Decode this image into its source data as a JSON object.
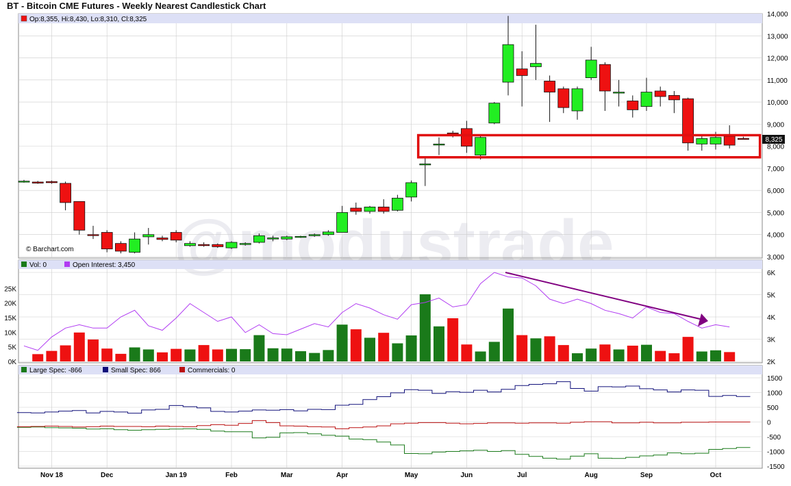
{
  "title": "BT - Bitcoin CME Futures - Weekly Nearest Candlestick Chart",
  "watermark": "@modustrade",
  "colors": {
    "up": "#22ee22",
    "down": "#ee1111",
    "vol_up": "#1a7a1a",
    "vol_down": "#ee1111",
    "oi": "#b13cf2",
    "large_spec": "#1a7a1a",
    "small_spec": "#10107a",
    "commercials": "#bb1111",
    "highlight": "#e01010",
    "arrow": "#800080",
    "legend_bg": "#dde0f6",
    "grid": "#cccccc"
  },
  "chart_data": [
    {
      "type": "candlestick",
      "legend": "Op:8,355, Hi:8,430, Lo:8,310, Cl:8,325",
      "copyright": "© Barchart.com",
      "last_label": "8,325",
      "ylim": [
        3000,
        14000
      ],
      "ytick_values": [
        3000,
        4000,
        5000,
        6000,
        7000,
        8000,
        9000,
        10000,
        11000,
        12000,
        13000,
        14000
      ],
      "ytick_labels": [
        "3,000",
        "4,000",
        "5,000",
        "6,000",
        "7,000",
        "8,000",
        "9,000",
        "10,000",
        "11,000",
        "12,000",
        "13,000",
        "14,000"
      ],
      "candles": [
        [
          6400,
          6480,
          6350,
          6420
        ],
        [
          6380,
          6430,
          6300,
          6330
        ],
        [
          6400,
          6450,
          6300,
          6350
        ],
        [
          6320,
          6400,
          5100,
          5450
        ],
        [
          5500,
          5500,
          4000,
          4200
        ],
        [
          4000,
          4400,
          3800,
          3960
        ],
        [
          4100,
          4200,
          3200,
          3350
        ],
        [
          3600,
          3700,
          3150,
          3250
        ],
        [
          3200,
          4100,
          3150,
          3800
        ],
        [
          3900,
          4300,
          3550,
          4000
        ],
        [
          3850,
          3950,
          3700,
          3780
        ],
        [
          4100,
          4200,
          3650,
          3750
        ],
        [
          3500,
          3700,
          3450,
          3600
        ],
        [
          3550,
          3650,
          3450,
          3500
        ],
        [
          3550,
          3600,
          3400,
          3450
        ],
        [
          3400,
          3700,
          3350,
          3650
        ],
        [
          3550,
          3650,
          3500,
          3600
        ],
        [
          3650,
          4050,
          3600,
          3950
        ],
        [
          3800,
          3950,
          3700,
          3850
        ],
        [
          3800,
          3950,
          3750,
          3900
        ],
        [
          3900,
          3950,
          3850,
          3920
        ],
        [
          3950,
          4050,
          3900,
          4000
        ],
        [
          4000,
          4200,
          3950,
          4120
        ],
        [
          4100,
          5300,
          4100,
          5000
        ],
        [
          5200,
          5450,
          4900,
          5050
        ],
        [
          5050,
          5300,
          4950,
          5250
        ],
        [
          5250,
          5600,
          4950,
          5050
        ],
        [
          5100,
          5800,
          5050,
          5650
        ],
        [
          5700,
          6450,
          5500,
          6350
        ],
        [
          7200,
          7500,
          6200,
          7200
        ],
        [
          8100,
          8400,
          7600,
          8100
        ],
        [
          8600,
          8700,
          8400,
          8550
        ],
        [
          8800,
          9150,
          7700,
          8000
        ],
        [
          7600,
          8500,
          7400,
          8400
        ],
        [
          9050,
          10000,
          9000,
          9950
        ],
        [
          10900,
          13900,
          10300,
          12600
        ],
        [
          11500,
          12300,
          9800,
          11200
        ],
        [
          11600,
          13500,
          11000,
          11750
        ],
        [
          10950,
          11200,
          9100,
          10450
        ],
        [
          10600,
          10700,
          9500,
          9750
        ],
        [
          9600,
          10700,
          9200,
          10600
        ],
        [
          11100,
          12500,
          11000,
          11900
        ],
        [
          11700,
          11800,
          9600,
          10500
        ],
        [
          10450,
          11000,
          9800,
          10450
        ],
        [
          10050,
          10300,
          9300,
          9650
        ],
        [
          9800,
          11100,
          9600,
          10450
        ],
        [
          10500,
          10700,
          9800,
          10250
        ],
        [
          10300,
          10500,
          9500,
          10100
        ],
        [
          10150,
          10200,
          7800,
          8150
        ],
        [
          8100,
          8500,
          7800,
          8350
        ],
        [
          8100,
          8650,
          7850,
          8400
        ],
        [
          8450,
          8950,
          7900,
          8050
        ],
        [
          8355,
          8430,
          8310,
          8325
        ]
      ],
      "x_ticks": [
        {
          "label": "Nov 18",
          "index": 2
        },
        {
          "label": "Dec",
          "index": 6
        },
        {
          "label": "Jan 19",
          "index": 11
        },
        {
          "label": "Feb",
          "index": 15
        },
        {
          "label": "Mar",
          "index": 19
        },
        {
          "label": "Apr",
          "index": 23
        },
        {
          "label": "May",
          "index": 28
        },
        {
          "label": "Jun",
          "index": 32
        },
        {
          "label": "Jul",
          "index": 36
        },
        {
          "label": "Aug",
          "index": 41
        },
        {
          "label": "Sep",
          "index": 45
        },
        {
          "label": "Oct",
          "index": 50
        }
      ],
      "highlight_box": {
        "x_from_index": 28.5,
        "x_to_index": 53.2,
        "y_from": 7500,
        "y_to": 8500
      }
    },
    {
      "type": "bar",
      "vol_label": "Vol: 0",
      "oi_label": "Open Interest: 3,450",
      "ylim_left": [
        0,
        30000
      ],
      "ytick_left_values": [
        0,
        5000,
        10000,
        15000,
        20000,
        25000
      ],
      "ytick_left_labels": [
        "0K",
        "5K",
        "10K",
        "15K",
        "20K",
        "25K"
      ],
      "ylim_right": [
        2000,
        6300
      ],
      "ytick_right_values": [
        2000,
        3000,
        4000,
        5000,
        6000
      ],
      "ytick_right_labels": [
        "2K",
        "3K",
        "4K",
        "5K",
        "6K"
      ],
      "volume": [
        0,
        2500,
        3600,
        5500,
        9900,
        7500,
        4400,
        2600,
        4800,
        4100,
        3100,
        4300,
        4100,
        5600,
        4100,
        4300,
        4200,
        9000,
        4500,
        4400,
        3500,
        2900,
        3900,
        12600,
        11000,
        8100,
        9800,
        6200,
        8900,
        23000,
        12000,
        14800,
        5800,
        3400,
        6700,
        18100,
        9000,
        7900,
        8600,
        5600,
        2800,
        4400,
        5800,
        4100,
        5400,
        5700,
        3600,
        2800,
        8400,
        3400,
        3800,
        3200,
        0
      ],
      "oi": [
        2700,
        2500,
        3100,
        3500,
        3650,
        3500,
        3500,
        4000,
        4300,
        3600,
        3400,
        3950,
        4600,
        4200,
        3800,
        4000,
        3300,
        3650,
        3250,
        3200,
        3450,
        3700,
        3550,
        4200,
        4600,
        4400,
        4100,
        3900,
        4550,
        4650,
        4850,
        4450,
        4550,
        5500,
        6000,
        5800,
        5750,
        5400,
        4800,
        4600,
        4800,
        4600,
        4300,
        4150,
        3950,
        4450,
        4200,
        4150,
        3800,
        3500,
        3650,
        3550,
        null
      ]
    },
    {
      "type": "line",
      "series": [
        {
          "name": "Large Spec: -866",
          "values": [
            -180,
            -170,
            -190,
            -200,
            -210,
            -240,
            -230,
            -260,
            -280,
            -260,
            -250,
            -240,
            -230,
            -250,
            -310,
            -330,
            -330,
            -540,
            -520,
            -370,
            -360,
            -400,
            -450,
            -480,
            -580,
            -600,
            -680,
            -780,
            -1070,
            -1080,
            -1020,
            -1000,
            -980,
            -960,
            -1000,
            -970,
            -1100,
            -1170,
            -1230,
            -1260,
            -1160,
            -1080,
            -1230,
            -1240,
            -1200,
            -1150,
            -1120,
            -1050,
            -1080,
            -1060,
            -930,
            -900,
            -866
          ]
        },
        {
          "name": "Small Spec: 866",
          "values": [
            320,
            310,
            340,
            370,
            390,
            310,
            360,
            340,
            300,
            410,
            430,
            560,
            520,
            480,
            360,
            340,
            370,
            410,
            400,
            420,
            380,
            430,
            420,
            570,
            600,
            760,
            860,
            990,
            1100,
            1080,
            970,
            1030,
            1010,
            1080,
            1020,
            1110,
            1240,
            1280,
            1300,
            1370,
            1140,
            1050,
            1200,
            1190,
            1220,
            1130,
            1090,
            1020,
            1090,
            1080,
            870,
            900,
            866
          ]
        },
        {
          "name": "Commercials: 0",
          "values": [
            -160,
            -150,
            -140,
            -150,
            -170,
            -160,
            -140,
            -150,
            -150,
            -160,
            -140,
            -150,
            -160,
            -120,
            -90,
            -110,
            -50,
            50,
            -20,
            -130,
            -140,
            -160,
            -170,
            -230,
            -190,
            -170,
            -130,
            -60,
            -40,
            -20,
            -20,
            -40,
            -60,
            -50,
            -30,
            -30,
            -40,
            -30,
            -30,
            -40,
            -10,
            10,
            10,
            -30,
            -30,
            -10,
            -30,
            -30,
            -10,
            -10,
            0,
            0,
            0
          ]
        }
      ],
      "ylim": [
        -1500,
        1600
      ],
      "ytick_values": [
        -1500,
        -1000,
        -500,
        0,
        500,
        1000,
        1500
      ],
      "ytick_labels": [
        "-1500",
        "-1000",
        "-500",
        "0",
        "500",
        "1000",
        "1500"
      ]
    }
  ]
}
